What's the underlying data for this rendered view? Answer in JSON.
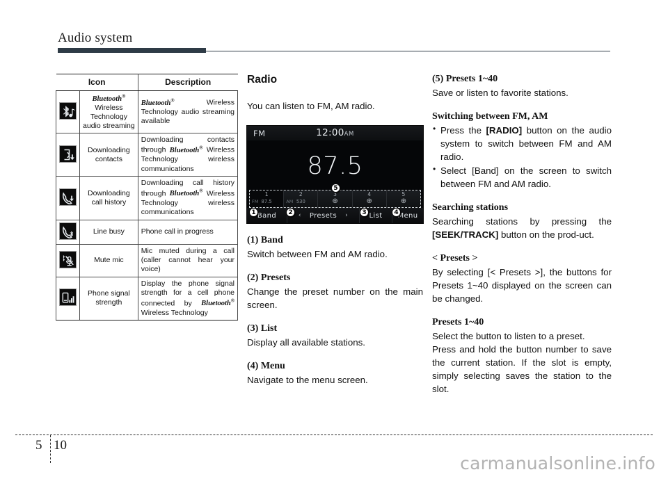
{
  "header": {
    "title": "Audio system"
  },
  "footer": {
    "chapter": "5",
    "page": "10",
    "watermark": "carmanualsonline.info"
  },
  "icon_table": {
    "headers": {
      "icon": "Icon",
      "description": "Description"
    },
    "rows": [
      {
        "icon_name": "bluetooth-audio-streaming-icon",
        "name_html": "Bluetooth® Wireless Technology audio streaming",
        "name_line1": "Bluetooth",
        "name_rest": "Wireless Technology audio streaming",
        "desc": "Bluetooth® Wireless Technology audio streaming available"
      },
      {
        "icon_name": "downloading-contacts-icon",
        "name": "Downloading contacts",
        "desc": "Downloading contacts through Bluetooth® Wireless Technology wireless communications"
      },
      {
        "icon_name": "downloading-call-history-icon",
        "name": "Downloading call history",
        "desc": "Downloading call history through Bluetooth® Wireless Technology wireless communications"
      },
      {
        "icon_name": "line-busy-icon",
        "name": "Line busy",
        "desc": "Phone call in progress"
      },
      {
        "icon_name": "mute-mic-icon",
        "name": "Mute mic",
        "desc": "Mic muted during a call (caller cannot hear your voice)"
      },
      {
        "icon_name": "phone-signal-strength-icon",
        "name": "Phone signal strength",
        "desc": "Display the phone signal strength for a cell phone connected by Bluetooth® Wireless Technology"
      }
    ]
  },
  "middle": {
    "heading": "Radio",
    "intro": "You can listen to FM, AM radio.",
    "sections": [
      {
        "head": "(1) Band",
        "body": "Switch between FM and AM radio."
      },
      {
        "head": "(2) Presets",
        "body": "Change the preset number on the main screen."
      },
      {
        "head": "(3) List",
        "body": "Display all available stations."
      },
      {
        "head": "(4) Menu",
        "body": "Navigate to the menu screen."
      }
    ]
  },
  "radio_screen": {
    "band_label": "FM",
    "clock_time": "12:00",
    "clock_ampm": "AM",
    "frequency": "87.5",
    "presets": [
      {
        "num": "1",
        "band": "FM",
        "freq": "87.5",
        "empty": false,
        "active": true
      },
      {
        "num": "2",
        "band": "AM",
        "freq": "530",
        "empty": false,
        "active": false
      },
      {
        "num": "3",
        "band": "",
        "freq": "",
        "empty": true,
        "active": false
      },
      {
        "num": "4",
        "band": "",
        "freq": "",
        "empty": true,
        "active": false
      },
      {
        "num": "5",
        "band": "",
        "freq": "",
        "empty": true,
        "active": false
      }
    ],
    "empty_slot_glyph": "⊕",
    "buttons": {
      "band": "Band",
      "presets": "Presets",
      "prev_arrow": "‹",
      "next_arrow": "›",
      "list": "List",
      "menu": "Menu"
    },
    "callouts": [
      "1",
      "2",
      "3",
      "4",
      "5"
    ]
  },
  "right": {
    "presets_head": "(5) Presets 1~40",
    "presets_body": "Save or listen to favorite stations.",
    "switching_head": "Switching between FM, AM",
    "switching_bullets": [
      {
        "pre": "Press the ",
        "bold": "[RADIO]",
        "post": " button on the audio system to switch between FM and AM radio."
      },
      {
        "pre": "Select [Band] on the screen to switch between FM and AM radio.",
        "bold": "",
        "post": ""
      }
    ],
    "searching_head": "Searching stations",
    "searching_body_pre": "Searching stations by pressing the ",
    "searching_body_bold": "[SEEK/TRACK]",
    "searching_body_post": " button on the prod-uct.",
    "presets_bracket_head": "< Presets >",
    "presets_bracket_body": "By selecting [< Presets >], the buttons for Presets 1~40 displayed on the screen can be changed.",
    "presets40_head": "Presets 1~40",
    "presets40_body1": "Select the button to listen to a preset.",
    "presets40_body2": "Press and hold the button number to save the current station. If the slot is empty, simply selecting saves the station to the slot."
  }
}
